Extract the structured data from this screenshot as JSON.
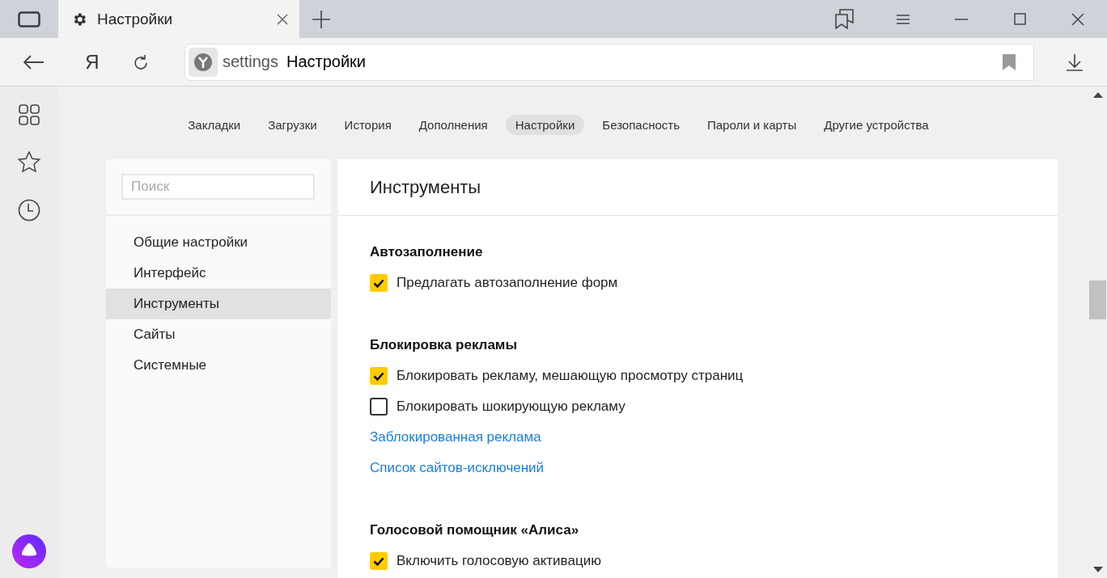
{
  "tab": {
    "title": "Настройки",
    "selected": true
  },
  "toolbar": {
    "home_glyph": "Я",
    "address_scheme": "settings",
    "address_title": "Настройки"
  },
  "nav_tabs": [
    {
      "label": "Закладки",
      "selected": false
    },
    {
      "label": "Загрузки",
      "selected": false
    },
    {
      "label": "История",
      "selected": false
    },
    {
      "label": "Дополнения",
      "selected": false
    },
    {
      "label": "Настройки",
      "selected": true
    },
    {
      "label": "Безопасность",
      "selected": false
    },
    {
      "label": "Пароли и карты",
      "selected": false
    },
    {
      "label": "Другие устройства",
      "selected": false
    }
  ],
  "search": {
    "placeholder": "Поиск"
  },
  "sidebar": {
    "items": [
      {
        "label": "Общие настройки",
        "selected": false
      },
      {
        "label": "Интерфейс",
        "selected": false
      },
      {
        "label": "Инструменты",
        "selected": true
      },
      {
        "label": "Сайты",
        "selected": false
      },
      {
        "label": "Системные",
        "selected": false
      }
    ]
  },
  "panel": {
    "title": "Инструменты",
    "sections": [
      {
        "title": "Автозаполнение",
        "items": [
          {
            "kind": "checkbox",
            "label": "Предлагать автозаполнение форм",
            "checked": true
          }
        ]
      },
      {
        "title": "Блокировка рекламы",
        "items": [
          {
            "kind": "checkbox",
            "label": "Блокировать рекламу, мешающую просмотру страниц",
            "checked": true
          },
          {
            "kind": "checkbox",
            "label": "Блокировать шокирующую рекламу",
            "checked": false
          },
          {
            "kind": "link",
            "label": "Заблокированная реклама"
          },
          {
            "kind": "link",
            "label": "Список сайтов-исключений"
          }
        ]
      },
      {
        "title": "Голосовой помощник «Алиса»",
        "items": [
          {
            "kind": "checkbox",
            "label": "Включить голосовую активацию",
            "checked": true
          }
        ]
      }
    ]
  }
}
